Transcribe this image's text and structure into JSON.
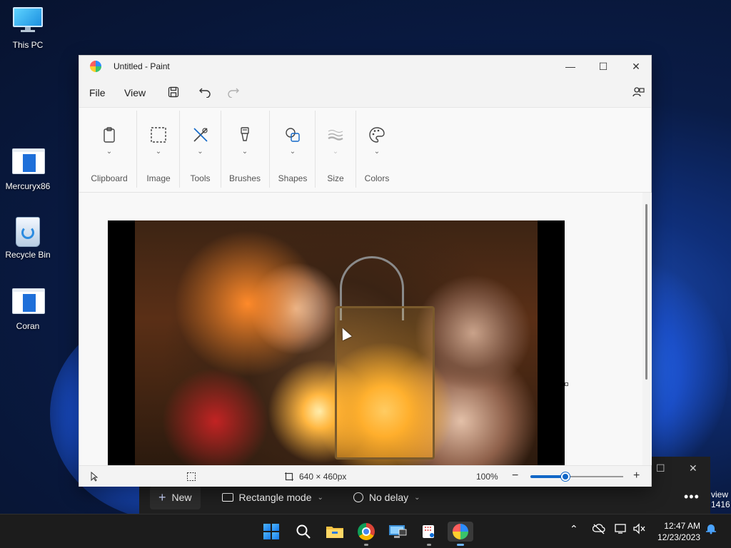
{
  "desktop": {
    "icons": [
      {
        "label": "This PC"
      },
      {
        "label": "Mercuryx86"
      },
      {
        "label": "Recycle Bin"
      },
      {
        "label": "Coran"
      }
    ]
  },
  "snipping_tool": {
    "new_label": "New",
    "mode_label": "Rectangle mode",
    "delay_label": "No delay",
    "side_text_1": "view",
    "side_text_2": "1416"
  },
  "paint": {
    "title": "Untitled - Paint",
    "menu": {
      "file": "File",
      "view": "View"
    },
    "ribbon_groups": [
      {
        "label": "Clipboard",
        "icon": "clipboard-icon"
      },
      {
        "label": "Image",
        "icon": "selection-icon"
      },
      {
        "label": "Tools",
        "icon": "tools-icon"
      },
      {
        "label": "Brushes",
        "icon": "brush-icon"
      },
      {
        "label": "Shapes",
        "icon": "shapes-icon"
      },
      {
        "label": "Size",
        "icon": "size-icon"
      },
      {
        "label": "Colors",
        "icon": "palette-icon"
      }
    ],
    "status": {
      "canvas_size": "640 × 460px",
      "zoom": "100%",
      "zoom_level_fraction": 0.38
    }
  },
  "taskbar": {
    "clock_time": "12:47 AM",
    "clock_date": "12/23/2023"
  },
  "colors": {
    "accent": "#1167c7",
    "taskbar": "#1c1c1c"
  }
}
